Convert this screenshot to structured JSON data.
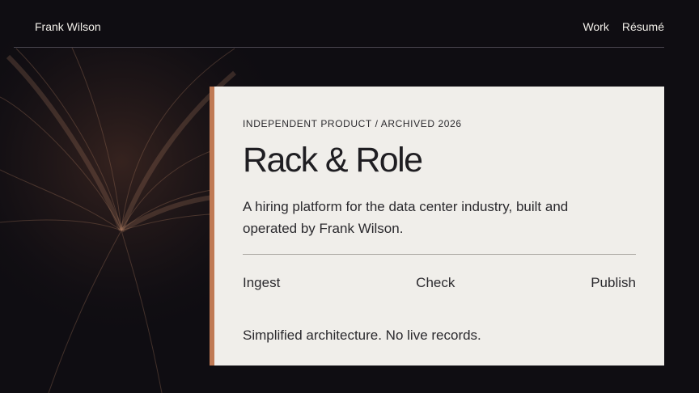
{
  "header": {
    "brand": "Frank Wilson",
    "nav": [
      {
        "label": "Work"
      },
      {
        "label": "Résumé"
      }
    ]
  },
  "project": {
    "eyebrow": "INDEPENDENT PRODUCT / ARCHIVED 2026",
    "title": "Rack & Role",
    "description": "A hiring platform for the data center industry, built and operated by Frank Wilson.",
    "steps": [
      "Ingest",
      "Check",
      "Publish"
    ],
    "note": "Simplified architecture. No live records."
  },
  "colors": {
    "background": "#0f0d12",
    "card": "#f0eeea",
    "accent": "#c07a55",
    "text_light": "#f2efe9",
    "text_dark": "#2b2a2e"
  }
}
